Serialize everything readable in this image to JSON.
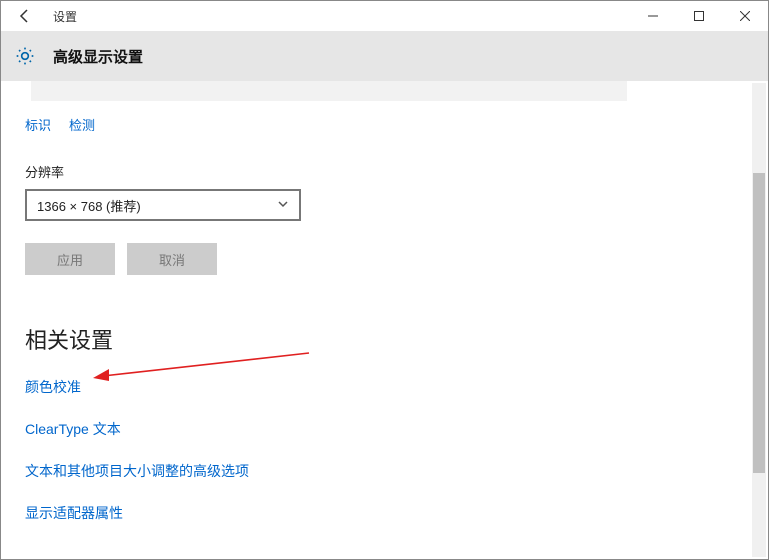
{
  "window": {
    "app_title": "设置",
    "page_title": "高级显示设置"
  },
  "links_top": {
    "identify": "标识",
    "detect": "检测"
  },
  "resolution": {
    "label": "分辨率",
    "selected": "1366 × 768 (推荐)"
  },
  "buttons": {
    "apply": "应用",
    "cancel": "取消"
  },
  "related": {
    "heading": "相关设置",
    "color_calibration": "颜色校准",
    "cleartype": "ClearType 文本",
    "advanced_sizing": "文本和其他项目大小调整的高级选项",
    "adapter_properties": "显示适配器属性"
  }
}
